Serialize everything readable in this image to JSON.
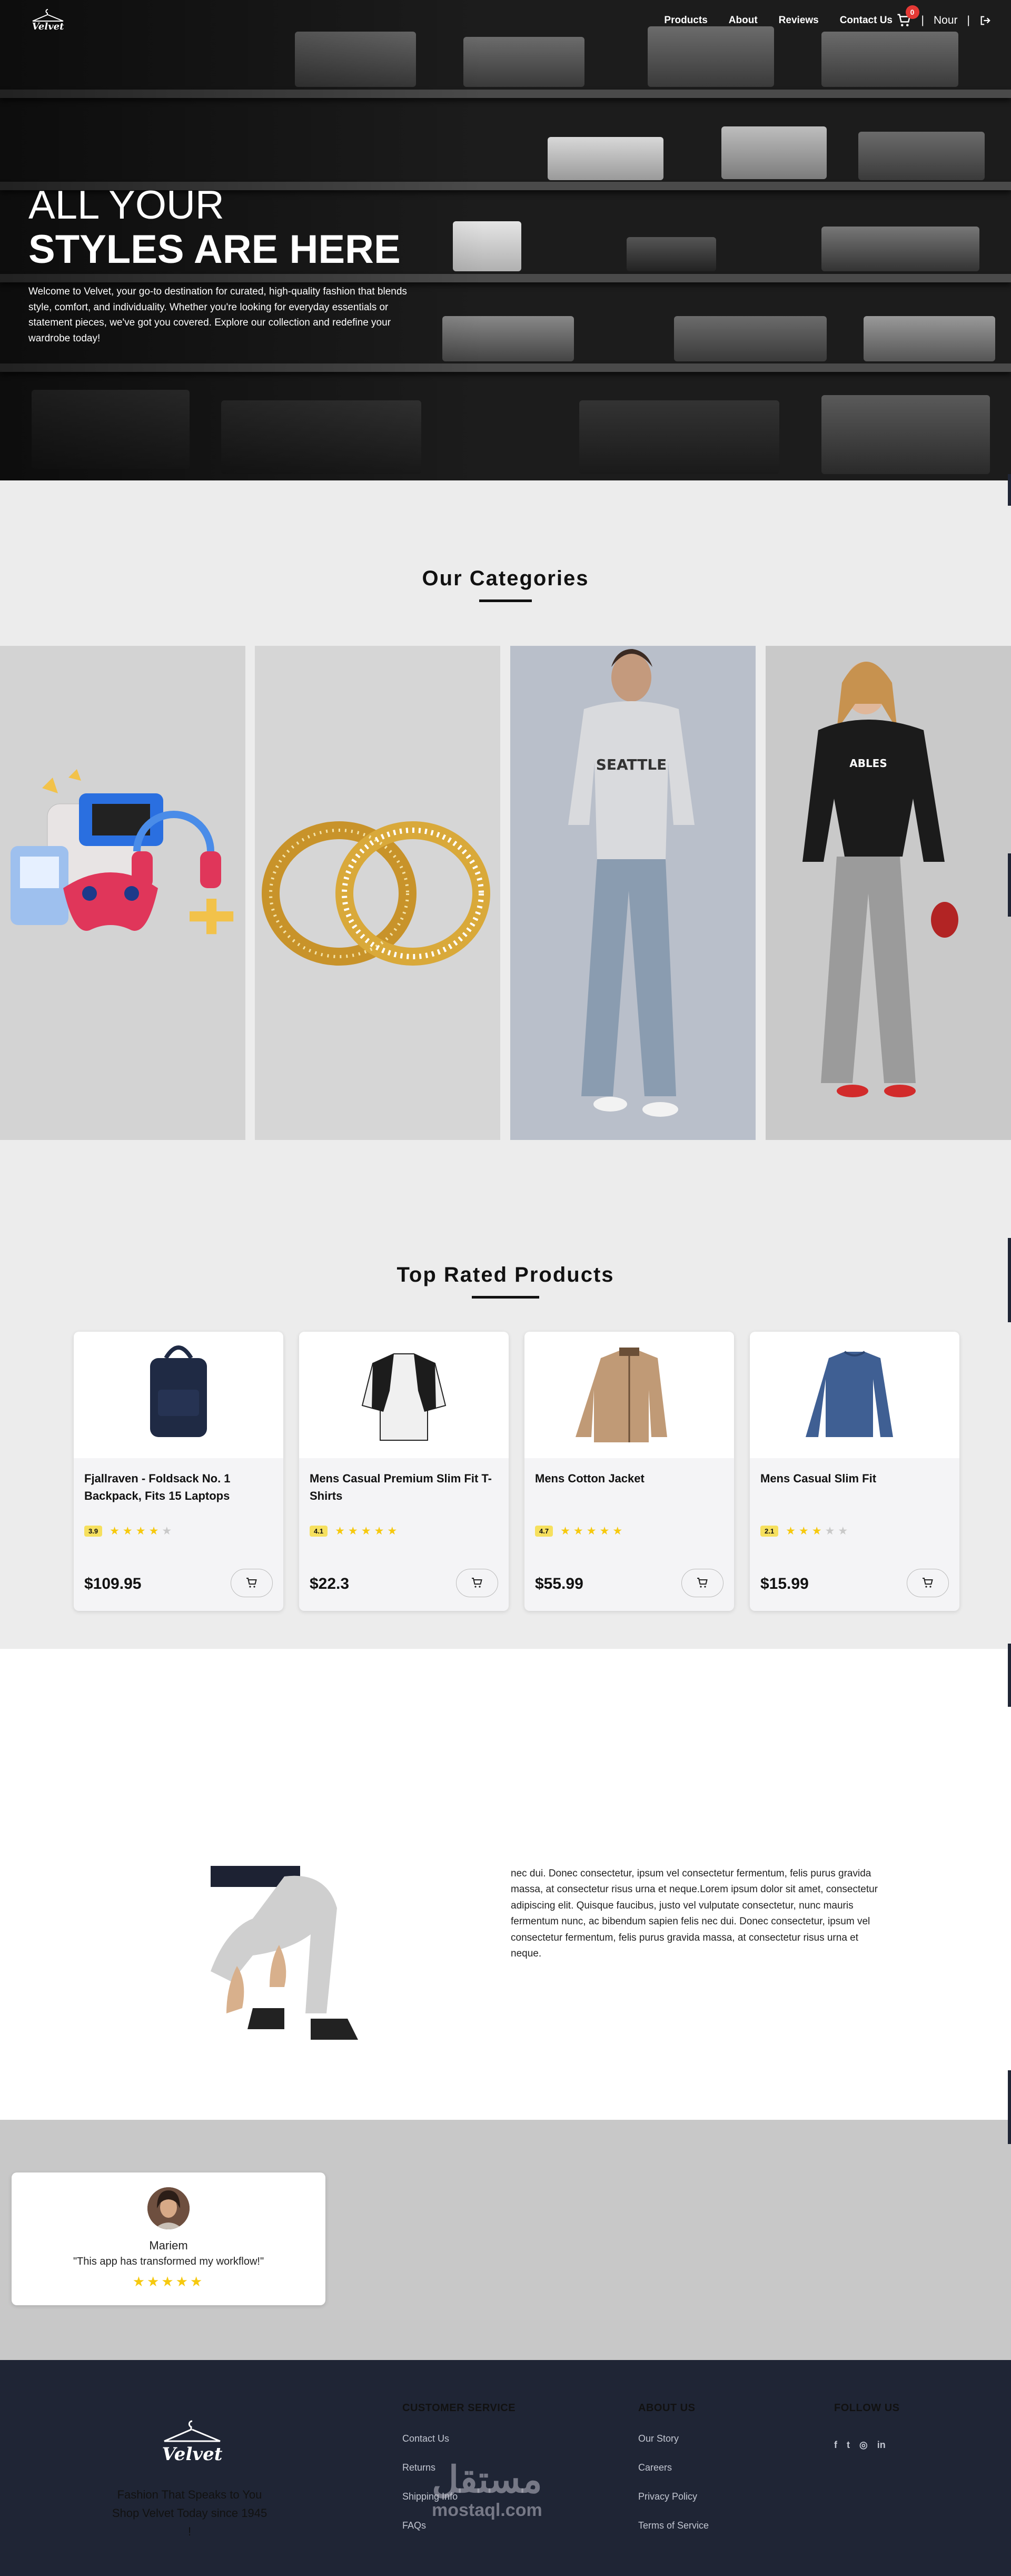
{
  "nav": {
    "links": [
      "Products",
      "About",
      "Reviews",
      "Contact Us"
    ],
    "cart_count": "0",
    "user_name": "Nour",
    "separator": "|"
  },
  "hero": {
    "line1": "ALL YOUR",
    "line2": "STYLES ARE HERE",
    "description": "Welcome to Velvet, your go-to destination for curated, high-quality fashion that blends style, comfort, and individuality. Whether you're looking for everyday essentials or statement pieces, we've got you covered. Explore our collection and redefine your wardrobe today!"
  },
  "categories": {
    "title": "Our Categories"
  },
  "products": {
    "title": "Top Rated Products",
    "items": [
      {
        "name": "Fjallraven - Foldsack No. 1 Backpack, Fits 15 Laptops",
        "rating": "3.9",
        "stars": 3.9,
        "price": "$109.95"
      },
      {
        "name": "Mens Casual Premium Slim Fit T-Shirts",
        "rating": "4.1",
        "stars": 4.1,
        "price": "$22.3"
      },
      {
        "name": "Mens Cotton Jacket",
        "rating": "4.7",
        "stars": 4.7,
        "price": "$55.99"
      },
      {
        "name": "Mens Casual Slim Fit",
        "rating": "2.1",
        "stars": 2.1,
        "price": "$15.99"
      }
    ]
  },
  "about": {
    "text": "nec dui. Donec consectetur, ipsum vel consectetur fermentum, felis purus gravida massa, at consectetur risus urna et neque.Lorem ipsum dolor sit amet, consectetur adipiscing elit. Quisque faucibus, justo vel vulputate consectetur, nunc mauris fermentum nunc, ac bibendum sapien felis nec dui. Donec consectetur, ipsum vel consectetur fermentum, felis purus gravida massa, at consectetur risus urna et neque."
  },
  "review": {
    "name": "Mariem",
    "text": "\"This app has transformed my workflow!\"",
    "stars": "★★★★★"
  },
  "footer": {
    "logo_text": "Velvet",
    "tagline": "Fashion That Speaks to You Shop Velvet Today since 1945 !",
    "customer_service": {
      "title": "CUSTOMER SERVICE",
      "links": [
        "Contact Us",
        "Returns",
        "Shipping Info",
        "FAQs"
      ]
    },
    "about_us": {
      "title": "ABOUT US",
      "links": [
        "Our Story",
        "Careers",
        "Privacy Policy",
        "Terms of Service"
      ]
    },
    "follow": {
      "title": "FOLLOW US",
      "icons": [
        "facebook-icon",
        "twitter-icon",
        "instagram-icon",
        "linkedin-icon"
      ]
    }
  },
  "watermark": {
    "arabic": "مستقل",
    "latin": "mostaql.com"
  },
  "colors": {
    "footer_bg": "#1f2535",
    "badge": "#e53935",
    "star": "#f6c90e",
    "rating_box": "#f6e05e"
  }
}
